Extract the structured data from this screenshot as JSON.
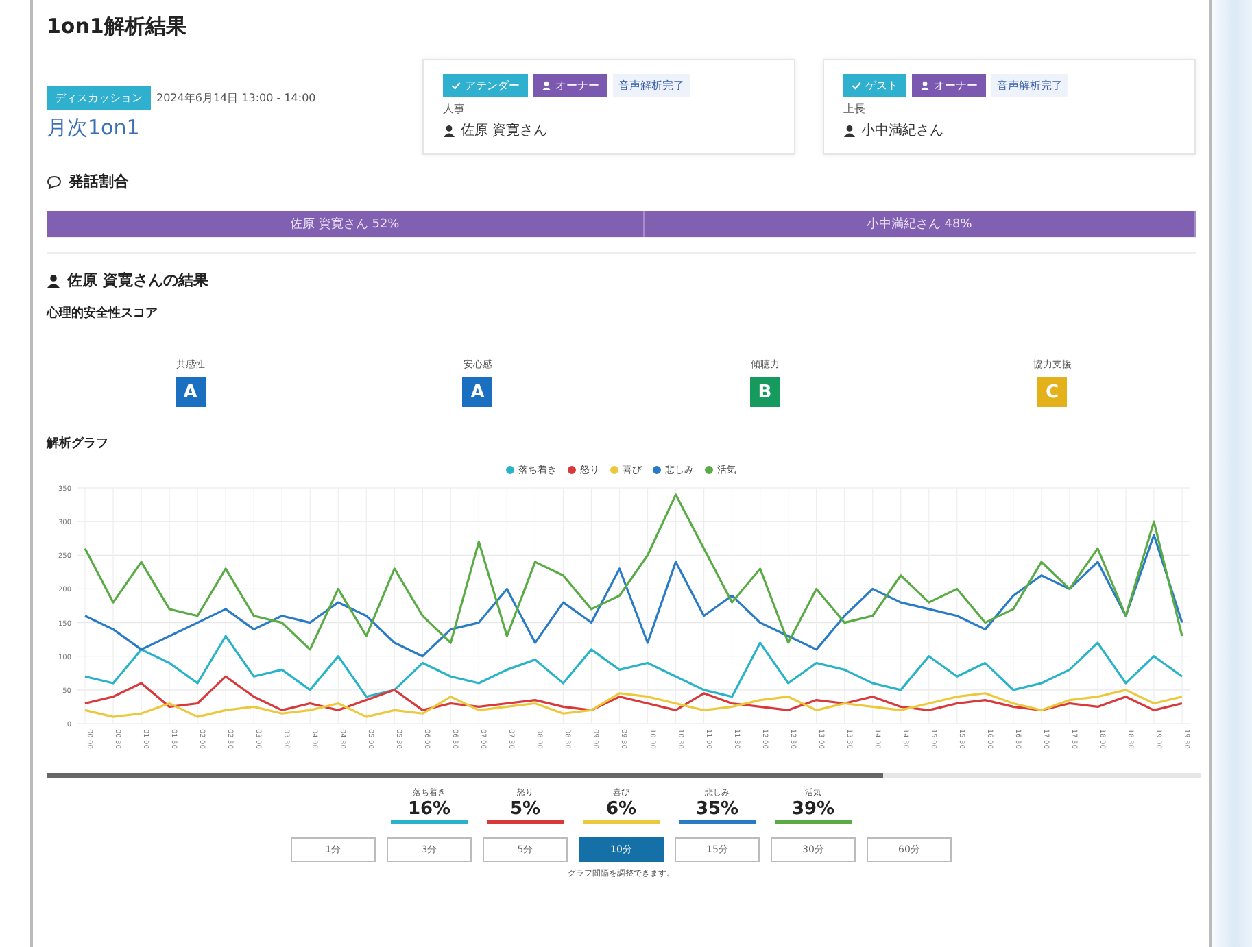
{
  "title": "1on1解析結果",
  "meeting": {
    "badge": "ディスカッション",
    "datetime": "2024年6月14日 13:00 - 14:00",
    "name": "月次1on1"
  },
  "participants": [
    {
      "badges": [
        {
          "kind": "check",
          "label": "アテンダー"
        },
        {
          "kind": "user",
          "label": "オーナー"
        }
      ],
      "status": "音声解析完了",
      "role": "人事",
      "name": "佐原 資寛さん"
    },
    {
      "badges": [
        {
          "kind": "check",
          "label": "ゲスト"
        },
        {
          "kind": "user",
          "label": "オーナー"
        }
      ],
      "status": "音声解析完了",
      "role": "上長",
      "name": "小中満紀さん"
    }
  ],
  "speech_ratio": {
    "heading": "発話割合",
    "segments": [
      {
        "label": "佐原 資寛さん 52%",
        "level": 0.52
      },
      {
        "label": "小中満紀さん 48%",
        "level": 0.48
      }
    ]
  },
  "result": {
    "heading": "佐原 資寛さんの結果",
    "score_heading": "心理的安全性スコア",
    "scores": [
      {
        "label": "共感性",
        "grade": "A",
        "color": "#1a6fc0"
      },
      {
        "label": "安心感",
        "grade": "A",
        "color": "#1a6fc0"
      },
      {
        "label": "傾聴力",
        "grade": "B",
        "color": "#179a5e"
      },
      {
        "label": "協力支援",
        "grade": "C",
        "color": "#e3b21b"
      }
    ],
    "graph_heading": "解析グラフ",
    "chart_data": {
      "type": "line",
      "grid": true,
      "x": [
        "00:00",
        "00:30",
        "01:00",
        "01:30",
        "02:00",
        "02:30",
        "03:00",
        "03:30",
        "04:00",
        "04:30",
        "05:00",
        "05:30",
        "06:00",
        "06:30",
        "07:00",
        "07:30",
        "08:00",
        "08:30",
        "09:00",
        "09:30",
        "10:00",
        "10:30",
        "11:00",
        "11:30",
        "12:00",
        "12:30",
        "13:00",
        "13:30",
        "14:00",
        "14:30",
        "15:00",
        "15:30",
        "16:00",
        "16:30",
        "17:00",
        "17:30",
        "18:00",
        "18:30",
        "19:00",
        "19:30"
      ],
      "ylim": [
        0,
        350
      ],
      "yticks": [
        0,
        50,
        100,
        150,
        200,
        250,
        300,
        350
      ],
      "series": [
        {
          "name": "落ち着き",
          "color": "#29b3c8",
          "values": [
            70,
            60,
            110,
            90,
            60,
            130,
            70,
            80,
            50,
            100,
            40,
            50,
            90,
            70,
            60,
            80,
            95,
            60,
            110,
            80,
            90,
            70,
            50,
            40,
            120,
            60,
            90,
            80,
            60,
            50,
            100,
            70,
            90,
            50,
            60,
            80,
            120,
            60,
            100,
            70
          ]
        },
        {
          "name": "怒り",
          "color": "#d8393b",
          "values": [
            30,
            40,
            60,
            25,
            30,
            70,
            40,
            20,
            30,
            20,
            35,
            50,
            20,
            30,
            25,
            30,
            35,
            25,
            20,
            40,
            30,
            20,
            45,
            30,
            25,
            20,
            35,
            30,
            40,
            25,
            20,
            30,
            35,
            25,
            20,
            30,
            25,
            40,
            20,
            30
          ]
        },
        {
          "name": "喜び",
          "color": "#ecc93c",
          "values": [
            20,
            10,
            15,
            30,
            10,
            20,
            25,
            15,
            20,
            30,
            10,
            20,
            15,
            40,
            20,
            25,
            30,
            15,
            20,
            45,
            40,
            30,
            20,
            25,
            35,
            40,
            20,
            30,
            25,
            20,
            30,
            40,
            45,
            30,
            20,
            35,
            40,
            50,
            30,
            40
          ]
        },
        {
          "name": "悲しみ",
          "color": "#2a7bc6",
          "values": [
            160,
            140,
            110,
            130,
            150,
            170,
            140,
            160,
            150,
            180,
            160,
            120,
            100,
            140,
            150,
            200,
            120,
            180,
            150,
            230,
            120,
            240,
            160,
            190,
            150,
            130,
            110,
            160,
            200,
            180,
            170,
            160,
            140,
            190,
            220,
            200,
            240,
            160,
            280,
            150
          ]
        },
        {
          "name": "活気",
          "color": "#5aab46",
          "values": [
            260,
            180,
            240,
            170,
            160,
            230,
            160,
            150,
            110,
            200,
            130,
            230,
            160,
            120,
            270,
            130,
            240,
            220,
            170,
            190,
            250,
            340,
            260,
            180,
            230,
            120,
            200,
            150,
            160,
            220,
            180,
            200,
            150,
            170,
            240,
            200,
            260,
            160,
            300,
            130
          ]
        }
      ]
    }
  },
  "summary": [
    {
      "label": "落ち着き",
      "value": "16%",
      "color": "#29b3c8"
    },
    {
      "label": "怒り",
      "value": "5%",
      "color": "#d8393b"
    },
    {
      "label": "喜び",
      "value": "6%",
      "color": "#ecc93c"
    },
    {
      "label": "悲しみ",
      "value": "35%",
      "color": "#2a7bc6"
    },
    {
      "label": "活気",
      "value": "39%",
      "color": "#5aab46"
    }
  ],
  "intervals": [
    {
      "label": "1分",
      "selected": false
    },
    {
      "label": "3分",
      "selected": false
    },
    {
      "label": "5分",
      "selected": false
    },
    {
      "label": "10分",
      "selected": true
    },
    {
      "label": "15分",
      "selected": false
    },
    {
      "label": "30分",
      "selected": false
    },
    {
      "label": "60分",
      "selected": false
    }
  ],
  "note": "グラフ間隔を調整できます。"
}
